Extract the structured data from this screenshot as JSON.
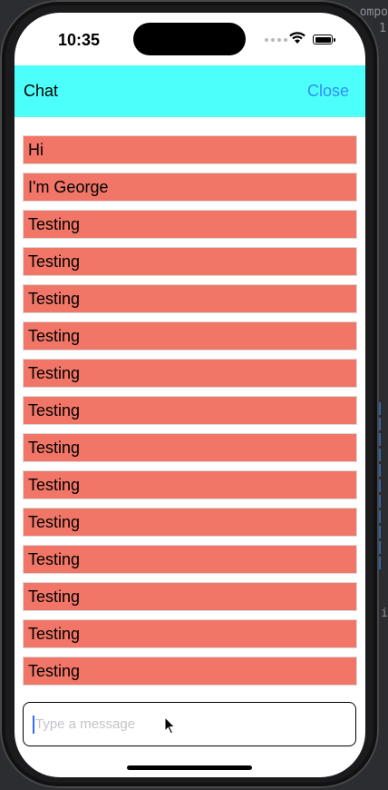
{
  "background": {
    "ide_text_top": "ompo",
    "ide_text_second": "1",
    "ide_text_bottom": "i"
  },
  "status_bar": {
    "time": "10:35"
  },
  "nav": {
    "title": "Chat",
    "close_label": "Close",
    "bar_color": "#4dfffa"
  },
  "messages": [
    {
      "text": "Hi"
    },
    {
      "text": "I'm George"
    },
    {
      "text": "Testing"
    },
    {
      "text": "Testing"
    },
    {
      "text": "Testing"
    },
    {
      "text": "Testing"
    },
    {
      "text": "Testing"
    },
    {
      "text": "Testing"
    },
    {
      "text": "Testing"
    },
    {
      "text": "Testing"
    },
    {
      "text": "Testing"
    },
    {
      "text": "Testing"
    },
    {
      "text": "Testing"
    },
    {
      "text": "Testing"
    },
    {
      "text": "Testing"
    }
  ],
  "message_color": "#f27667",
  "composer": {
    "value": "",
    "placeholder": "Type a message"
  },
  "icons": {
    "wifi": "wifi-icon",
    "battery": "battery-icon",
    "signal": "cellular-signal-icon",
    "pointer": "mouse-pointer-icon"
  }
}
